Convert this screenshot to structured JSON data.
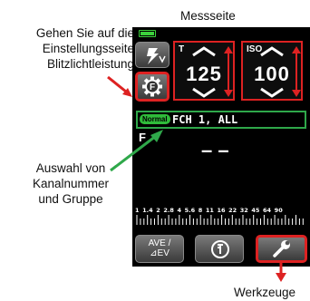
{
  "annotations": {
    "top_right": "Messseite",
    "top_left": [
      "Gehen Sie auf die",
      "Einstellungsseite",
      "Blitzlichtleistung"
    ],
    "middle_left": [
      "Auswahl von",
      "Kanalnummer",
      "und Gruppe"
    ],
    "bottom_right": "Werkzeuge"
  },
  "screen": {
    "t_label": "T",
    "t_value": "125",
    "iso_label": "ISO",
    "iso_value": "100",
    "mode_badge": "Normal",
    "channel_group": "FCH 1, ALL",
    "mode_letter": "F",
    "reading": "– –",
    "scale": [
      "1",
      "1.4",
      "2",
      "2.8",
      "4",
      "5.6",
      "8",
      "11",
      "16",
      "22",
      "32",
      "45",
      "64",
      "90"
    ],
    "ave_label_top": "AVE /",
    "ave_label_bottom": "⊿EV"
  },
  "colors": {
    "highlight_red": "#dd2222",
    "highlight_green": "#2fa84a",
    "battery_green": "#3cd23c"
  },
  "icons": {
    "flash_mode": "flash-mode-icon",
    "settings": "flash-settings-gear-icon",
    "memory": "memory-icon",
    "tools": "wrench-icon"
  }
}
